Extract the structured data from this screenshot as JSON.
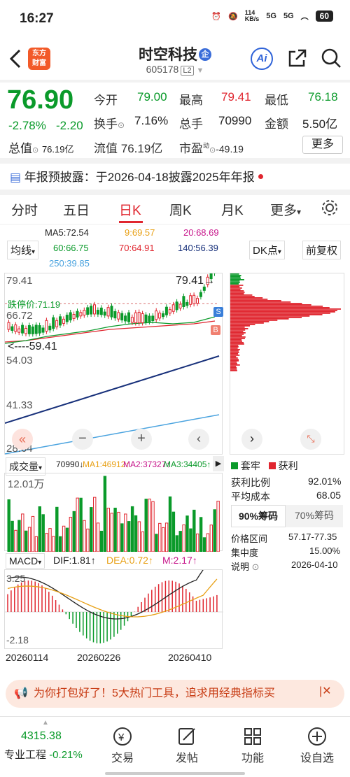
{
  "status": {
    "time": "16:27",
    "net_speed": "114\nKB/s",
    "sig1": "5G",
    "sig2": "5G",
    "battery": "60"
  },
  "header": {
    "logo_text": "东方财富",
    "name": "时空科技",
    "name_badge": "企",
    "code": "605178",
    "level": "L2",
    "ai_label": "Ai"
  },
  "quote": {
    "price": "76.90",
    "change_pct": "-2.78%",
    "change": "-2.20",
    "rows": [
      [
        {
          "l": "今开",
          "v": "79.00",
          "c": "green"
        },
        {
          "l": "最高",
          "v": "79.41",
          "c": "red"
        },
        {
          "l": "最低",
          "v": "76.18",
          "c": "green"
        }
      ],
      [
        {
          "l": "换手",
          "v": "7.16%",
          "c": "dark"
        },
        {
          "l": "总手",
          "v": "70990",
          "c": "dark"
        },
        {
          "l": "金额",
          "v": "5.50亿",
          "c": "dark"
        }
      ]
    ],
    "zongzhi_label": "总值",
    "zongzhi_val": "76.19亿",
    "liutong_label": "流值",
    "liutong_val": "76.19亿",
    "pe_label": "市盈",
    "pe_sup": "动",
    "pe_val": "-49.19",
    "more": "更多"
  },
  "notice": {
    "text": "年报预披露：于2026-04-18披露2025年年报"
  },
  "tabs": [
    "分时",
    "五日",
    "日K",
    "周K",
    "月K",
    "更多"
  ],
  "active_tab": "日K",
  "ma": {
    "ma5": "MA5:72.54",
    "ma9": "9:69.57",
    "ma20": "20:68.69",
    "ma60": "60:66.75",
    "ma70": "70:64.91",
    "ma140": "140:56.39",
    "ma250": "250:39.85",
    "junxian": "均线",
    "dk": "DK点",
    "fuquan": "前复权"
  },
  "kline": {
    "y_labels": [
      "79.41",
      "66.72",
      "54.03",
      "41.33",
      "28.64"
    ],
    "high_label": "79.41",
    "low_label": "59.41",
    "limit_down": "跌停价:71.19",
    "s_badge": "S",
    "b_badge": "B"
  },
  "chip": {
    "legend_tao": "套牢",
    "legend_huo": "获利",
    "rows": [
      {
        "l": "获利比例",
        "v": "92.01%"
      },
      {
        "l": "平均成本",
        "v": "68.05"
      }
    ],
    "tab90": "90%筹码",
    "tab70": "70%筹码",
    "rows2": [
      {
        "l": "价格区间",
        "v": "57.17-77.35"
      },
      {
        "l": "集中度",
        "v": "15.00%"
      },
      {
        "l": "说明",
        "v": "2026-04-10"
      }
    ]
  },
  "volume": {
    "label": "成交量",
    "val": "70990",
    "ma1": "MA1:46912",
    "ma2": "MA2:37327",
    "ma3": "MA3:34405",
    "max_label": "12.01万"
  },
  "macd": {
    "label": "MACD",
    "dif": "DIF:1.81",
    "dea": "DEA:0.72",
    "m": "M:2.17",
    "top": "3.25",
    "bottom": "-2.18"
  },
  "dates": [
    "20260114",
    "20260226",
    "20260410"
  ],
  "ad": {
    "text": "为你打包好了！5大热门工具，追求用经典指标买"
  },
  "tabbar": [
    {
      "l": "专业工程",
      "icon": "index-icon"
    },
    {
      "l": "交易",
      "icon": "trade-icon"
    },
    {
      "l": "发帖",
      "icon": "post-icon"
    },
    {
      "l": "功能",
      "icon": "grid-icon"
    },
    {
      "l": "设自选",
      "icon": "add-favorite-icon"
    }
  ],
  "index": {
    "value": "4315.38",
    "pct": "-0.21%"
  },
  "chart_data": {
    "type": "candlestick",
    "ylim": [
      28.64,
      79.41
    ],
    "volume_max": "12.01万",
    "macd_range": [
      -2.18,
      3.25
    ]
  }
}
